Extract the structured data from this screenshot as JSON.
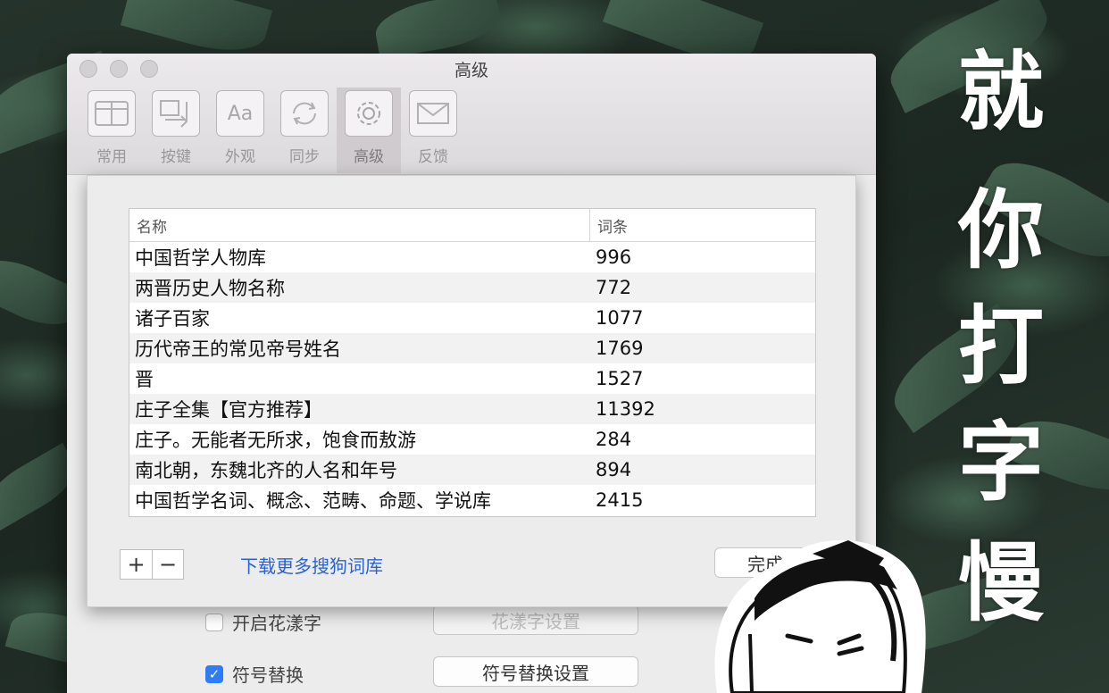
{
  "window": {
    "title": "高级",
    "toolbar": [
      {
        "label": "常用",
        "icon": "general-icon"
      },
      {
        "label": "按键",
        "icon": "keys-icon"
      },
      {
        "label": "外观",
        "icon": "appearance-icon"
      },
      {
        "label": "同步",
        "icon": "sync-icon"
      },
      {
        "label": "高级",
        "icon": "gear-icon",
        "active": true
      },
      {
        "label": "反馈",
        "icon": "mail-icon"
      }
    ],
    "icon_glyphs": {
      "appearance": "Aa"
    }
  },
  "lower": {
    "huayang_label": "开启花漾字",
    "huayang_checked": false,
    "huayang_button": "花漾字设置",
    "symbol_label": "符号替换",
    "symbol_checked": true,
    "symbol_button": "符号替换设置"
  },
  "sheet": {
    "columns": [
      "名称",
      "词条"
    ],
    "rows": [
      {
        "name": "中国哲学人物库",
        "count": "996"
      },
      {
        "name": "两晋历史人物名称",
        "count": "772"
      },
      {
        "name": "诸子百家",
        "count": "1077"
      },
      {
        "name": "历代帝王的常见帝号姓名",
        "count": "1769"
      },
      {
        "name": "晋",
        "count": "1527"
      },
      {
        "name": "庄子全集【官方推荐】",
        "count": "11392"
      },
      {
        "name": "庄子。无能者无所求，饱食而敖游",
        "count": "284"
      },
      {
        "name": "南北朝，东魏北齐的人名和年号",
        "count": "894"
      },
      {
        "name": "中国哲学名词、概念、范畴、命题、学说库",
        "count": "2415"
      }
    ],
    "add_label": "+",
    "remove_label": "−",
    "download_link": "下载更多搜狗词库",
    "done_label": "完成"
  },
  "overlay": {
    "chars": [
      "就",
      "你",
      "打",
      "字",
      "慢"
    ]
  },
  "colors": {
    "accent": "#2f7df6",
    "link": "#2a62d6",
    "overlay_text": "#ffffff"
  }
}
